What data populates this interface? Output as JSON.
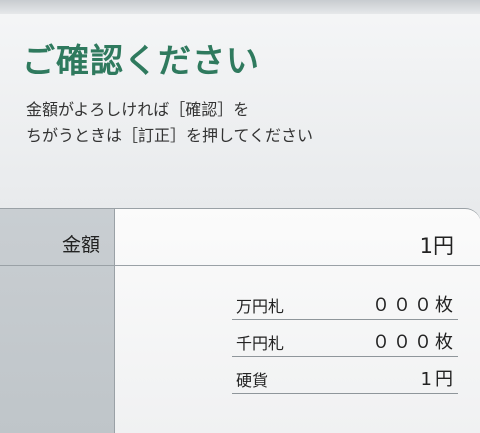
{
  "header": {
    "title": "ご確認ください"
  },
  "instructions": {
    "line1": "金額がよろしければ［確認］を",
    "line2": "ちがうときは［訂正］を押してください"
  },
  "amount": {
    "label": "金額",
    "value": "1円"
  },
  "breakdown": [
    {
      "label": "万円札",
      "value": "０００枚"
    },
    {
      "label": "千円札",
      "value": "０００枚"
    },
    {
      "label": "硬貨",
      "value": "1円"
    }
  ],
  "colors": {
    "title": "#2f7a5e",
    "label_column": "#c5cace",
    "value_area": "#f7f7f8"
  }
}
